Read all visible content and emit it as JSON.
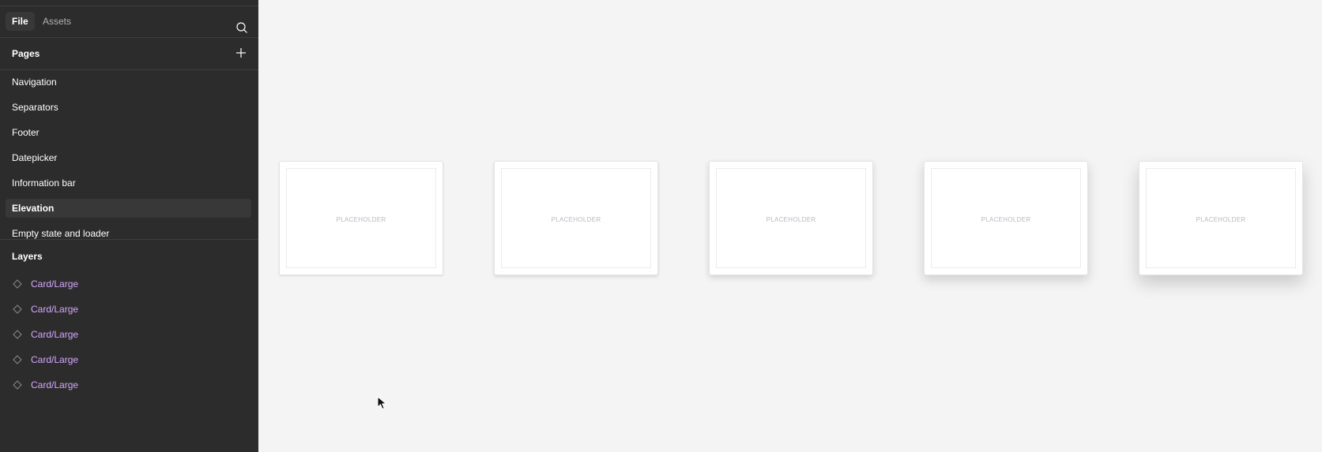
{
  "tabs": {
    "file": "File",
    "assets": "Assets"
  },
  "pages": {
    "title": "Pages",
    "items": [
      {
        "label": "Navigation"
      },
      {
        "label": "Separators"
      },
      {
        "label": "Footer"
      },
      {
        "label": "Datepicker"
      },
      {
        "label": "Information bar"
      },
      {
        "label": "Elevation",
        "selected": true
      },
      {
        "label": "Empty state and loader"
      }
    ]
  },
  "layers": {
    "title": "Layers",
    "items": [
      {
        "label": "Card/Large",
        "icon": "component-diamond-icon"
      },
      {
        "label": "Card/Large",
        "icon": "component-diamond-icon"
      },
      {
        "label": "Card/Large",
        "icon": "component-diamond-icon"
      },
      {
        "label": "Card/Large",
        "icon": "component-diamond-icon"
      },
      {
        "label": "Card/Large",
        "icon": "component-diamond-icon"
      }
    ]
  },
  "canvas": {
    "cards": [
      {
        "placeholder": "PLACEHOLDER"
      },
      {
        "placeholder": "PLACEHOLDER"
      },
      {
        "placeholder": "PLACEHOLDER"
      },
      {
        "placeholder": "PLACEHOLDER"
      },
      {
        "placeholder": "PLACEHOLDER"
      }
    ]
  },
  "colors": {
    "sidebar_bg": "#2c2c2c",
    "canvas_bg": "#f4f4f4",
    "component_accent": "#d5a6ff",
    "selected_bg": "#383838"
  }
}
